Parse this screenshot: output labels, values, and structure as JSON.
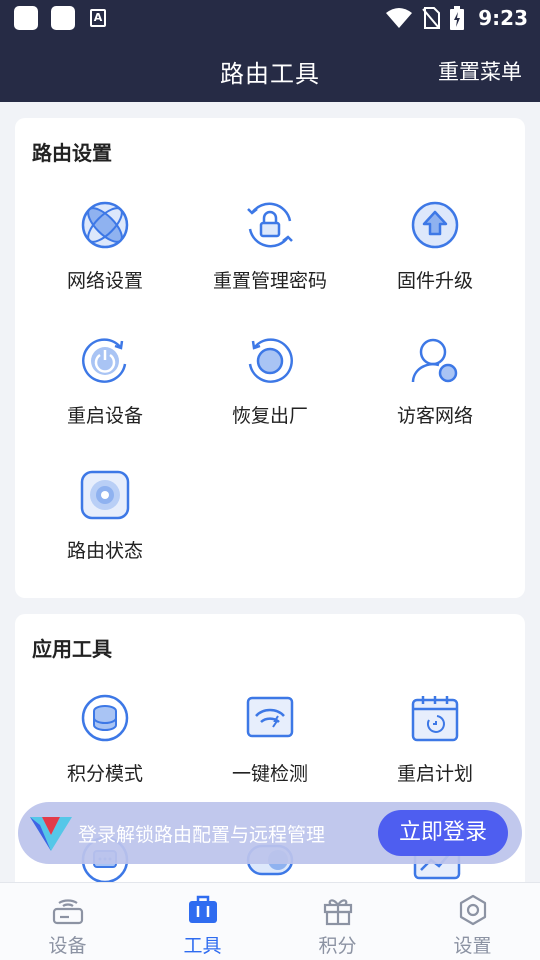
{
  "status_bar": {
    "time": "9:23",
    "notification_icon_letter": "A"
  },
  "header": {
    "title": "路由工具",
    "action": "重置菜单"
  },
  "router_settings": {
    "title": "路由设置",
    "items": [
      {
        "label": "网络设置",
        "icon": "globe-icon"
      },
      {
        "label": "重置管理密码",
        "icon": "lock-reset-icon"
      },
      {
        "label": "固件升级",
        "icon": "upgrade-icon"
      },
      {
        "label": "重启设备",
        "icon": "power-restart-icon"
      },
      {
        "label": "恢复出厂",
        "icon": "factory-reset-icon"
      },
      {
        "label": "访客网络",
        "icon": "guest-user-icon"
      },
      {
        "label": "路由状态",
        "icon": "router-status-icon"
      }
    ]
  },
  "app_tools": {
    "title": "应用工具",
    "items": [
      {
        "label": "积分模式",
        "icon": "points-mode-icon"
      },
      {
        "label": "一键检测",
        "icon": "wifi-check-icon"
      },
      {
        "label": "重启计划",
        "icon": "restart-calendar-icon"
      }
    ]
  },
  "banner": {
    "text": "登录解锁路由配置与远程管理",
    "button": "立即登录"
  },
  "tabbar": {
    "active": "工具",
    "tabs": [
      {
        "label": "设备",
        "icon": "router-device-icon"
      },
      {
        "label": "工具",
        "icon": "toolbox-icon"
      },
      {
        "label": "积分",
        "icon": "gift-icon"
      },
      {
        "label": "设置",
        "icon": "gear-icon"
      }
    ]
  },
  "colors": {
    "header_bg": "#262b45",
    "accent": "#2f6cf0",
    "icon_blue": "#3d78e6",
    "banner_button": "#4e5ef0"
  }
}
